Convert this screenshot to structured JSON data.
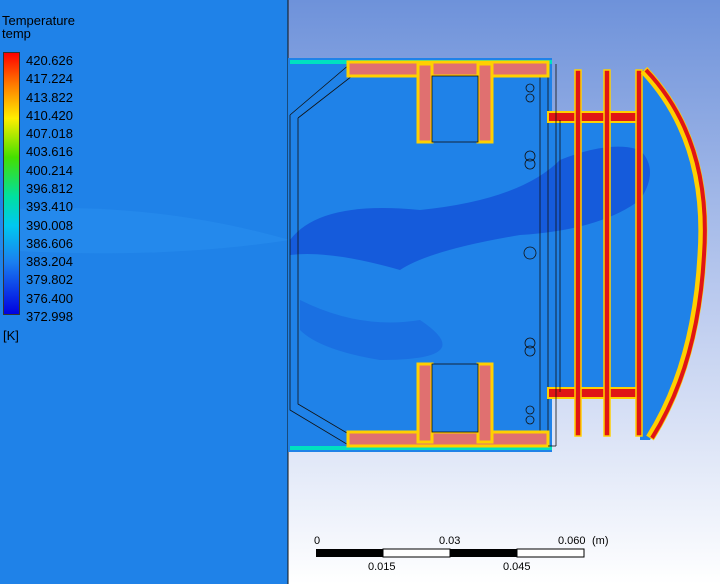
{
  "legend": {
    "title": "Temperature",
    "subtitle": "temp",
    "unit": "[K]",
    "ticks": [
      "420.626",
      "417.224",
      "413.822",
      "410.420",
      "407.018",
      "403.616",
      "400.214",
      "396.812",
      "393.410",
      "390.008",
      "386.606",
      "383.204",
      "379.802",
      "376.400",
      "372.998"
    ],
    "min": 372.998,
    "max": 420.626
  },
  "scale_bar": {
    "top_labels": [
      "0",
      "0.03",
      "0.060"
    ],
    "bottom_labels": [
      "0.015",
      "0.045"
    ],
    "unit": "(m)"
  },
  "colors": {
    "background_fluid": "#1f82e8",
    "hot_wall": "#e01515",
    "cold_core": "#1455d8"
  }
}
